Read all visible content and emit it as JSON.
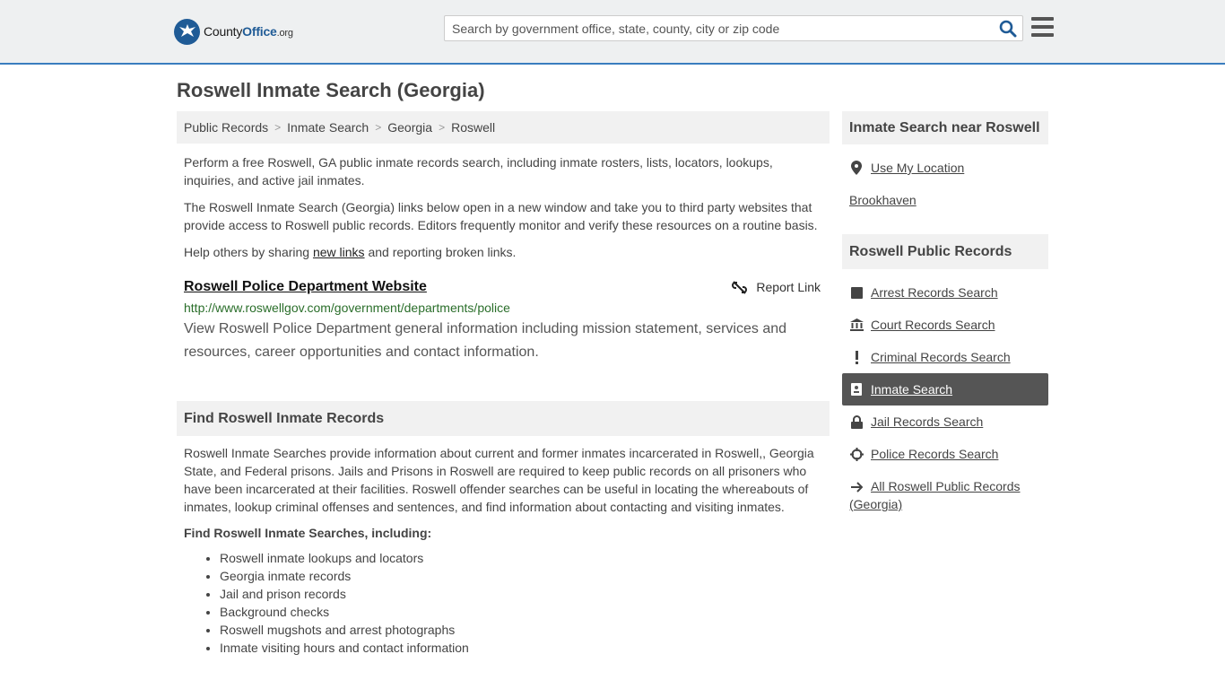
{
  "header": {
    "logo_main": "County",
    "logo_bold": "Office",
    "logo_org": ".org",
    "search_placeholder": "Search by government office, state, county, city or zip code"
  },
  "page": {
    "title": "Roswell Inmate Search (Georgia)"
  },
  "breadcrumb": [
    "Public Records",
    "Inmate Search",
    "Georgia",
    "Roswell"
  ],
  "intro": {
    "p1": "Perform a free Roswell, GA public inmate records search, including inmate rosters, lists, locators, lookups, inquiries, and active jail inmates.",
    "p2": "The Roswell Inmate Search (Georgia) links below open in a new window and take you to third party websites that provide access to Roswell public records. Editors frequently monitor and verify these resources on a routine basis.",
    "p3_before": "Help others by sharing ",
    "p3_link": "new links",
    "p3_after": " and reporting broken links."
  },
  "link": {
    "title": "Roswell Police Department Website",
    "report": "Report Link",
    "url": "http://www.roswellgov.com/government/departments/police",
    "description": "View Roswell Police Department general information including mission statement, services and resources, career opportunities and contact information."
  },
  "section": {
    "heading": "Find Roswell Inmate Records",
    "body": "Roswell Inmate Searches provide information about current and former inmates incarcerated in Roswell,, Georgia State, and Federal prisons. Jails and Prisons in Roswell are required to keep public records on all prisoners who have been incarcerated at their facilities. Roswell offender searches can be useful in locating the whereabouts of inmates, lookup criminal offenses and sentences, and find information about contacting and visiting inmates.",
    "subheading": "Find Roswell Inmate Searches, including:",
    "items": [
      "Roswell inmate lookups and locators",
      "Georgia inmate records",
      "Jail and prison records",
      "Background checks",
      "Roswell mugshots and arrest photographs",
      "Inmate visiting hours and contact information"
    ]
  },
  "sidebar": {
    "near_heading": "Inmate Search near Roswell",
    "use_location": "Use My Location",
    "nearby": "Brookhaven",
    "records_heading": "Roswell Public Records",
    "records": [
      {
        "label": "Arrest Records Search",
        "icon": "square-icon"
      },
      {
        "label": "Court Records Search",
        "icon": "courthouse-icon"
      },
      {
        "label": "Criminal Records Search",
        "icon": "exclamation-icon"
      },
      {
        "label": "Inmate Search",
        "icon": "badge-icon",
        "active": true
      },
      {
        "label": "Jail Records Search",
        "icon": "lock-icon"
      },
      {
        "label": "Police Records Search",
        "icon": "crosshair-icon"
      },
      {
        "label": "All Roswell Public Records (Georgia)",
        "icon": "arrow-right-icon"
      }
    ]
  },
  "colors": {
    "accent": "#3a7dbf",
    "url_green": "#2a6e2a",
    "active_bg": "#555555"
  }
}
